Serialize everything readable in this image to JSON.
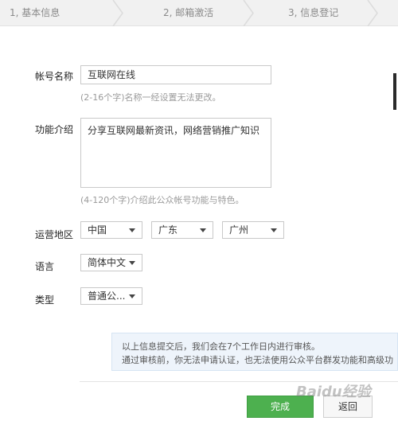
{
  "steps": [
    {
      "label": "1, 基本信息"
    },
    {
      "label": "2, 邮箱激活"
    },
    {
      "label": "3, 信息登记"
    }
  ],
  "form": {
    "account_name": {
      "label": "帐号名称",
      "value": "互联网在线",
      "hint": "(2-16个字)名称一经设置无法更改。"
    },
    "intro": {
      "label": "功能介绍",
      "value": "分享互联网最新资讯，网络营销推广知识",
      "hint": "(4-120个字)介绍此公众帐号功能与特色。"
    },
    "region": {
      "label": "运营地区",
      "country": "中国",
      "province": "广东",
      "city": "广州"
    },
    "language": {
      "label": "语言",
      "value": "简体中文"
    },
    "type": {
      "label": "类型",
      "value": "普通公..."
    }
  },
  "notice": {
    "line1": "以上信息提交后，我们会在7个工作日内进行审核。",
    "line2": "通过审核前，你无法申请认证，也无法使用公众平台群发功能和高级功"
  },
  "buttons": {
    "done": "完成",
    "back": "返回"
  },
  "watermark": "Baidu经验"
}
